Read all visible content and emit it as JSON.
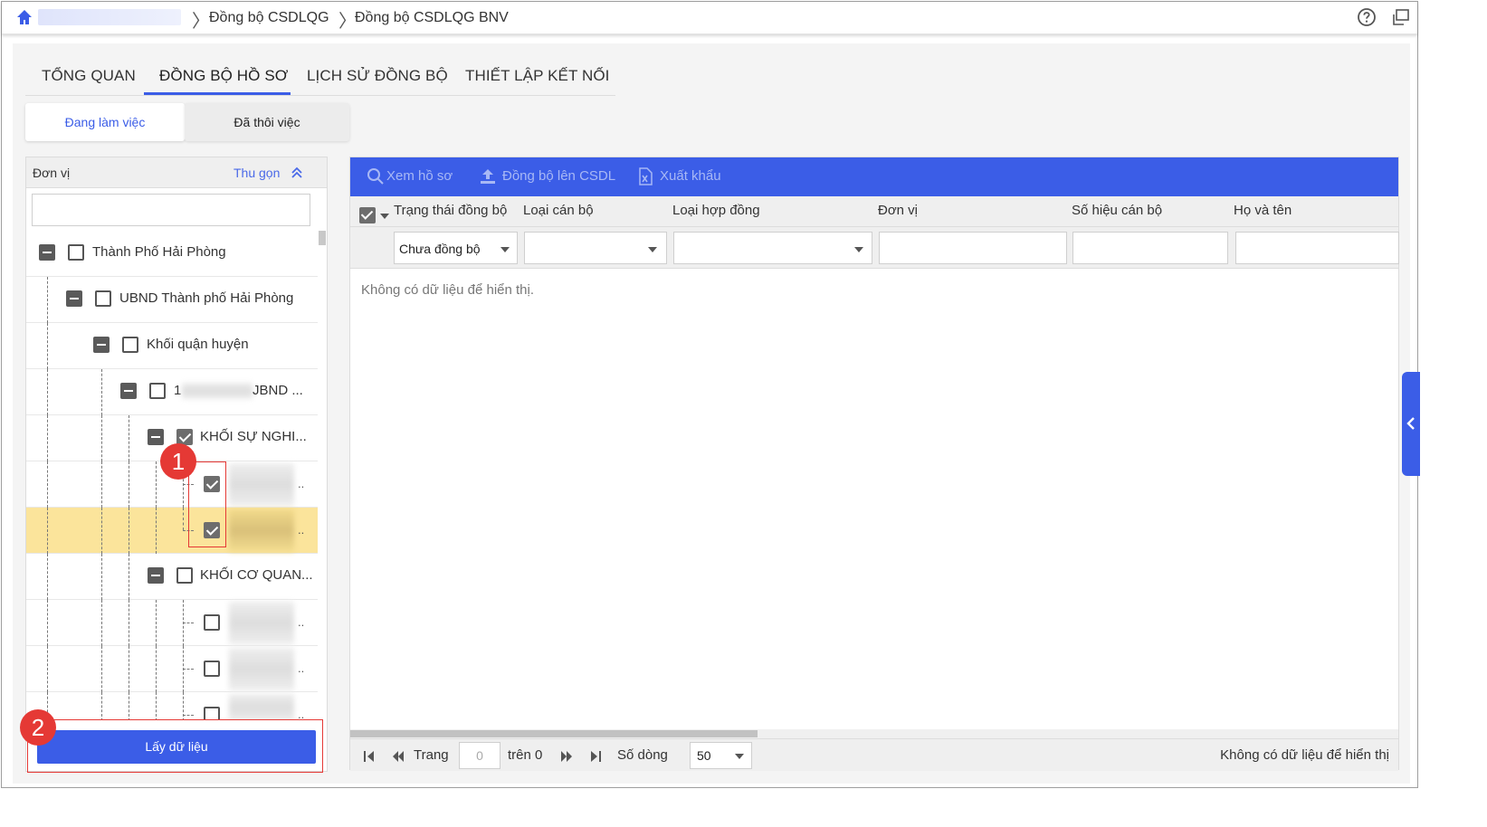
{
  "breadcrumb": {
    "items": [
      "Đồng bộ CSDLQG",
      "Đồng bộ CSDLQG BNV"
    ]
  },
  "tabs": [
    "TỔNG QUAN",
    "ĐỒNG BỘ HỒ SƠ",
    "LỊCH SỬ ĐỒNG BỘ",
    "THIẾT LẬP KẾT NỐI"
  ],
  "subtabs": [
    "Đang làm việc",
    "Đã thôi việc"
  ],
  "left_panel": {
    "title": "Đơn vị",
    "collapse_label": "Thu gọn",
    "tree": [
      {
        "label": "Thành Phố Hải Phòng",
        "checked": false
      },
      {
        "label": "UBND Thành phố Hải Phòng",
        "checked": false
      },
      {
        "label": "Khối quận huyện",
        "checked": false
      },
      {
        "label_prefix": "1",
        "label_suffix": "JBND ...",
        "checked": false
      },
      {
        "label": "KHỐI SỰ NGHI...",
        "checked": true
      },
      {
        "ellipsis": "..",
        "checked": true
      },
      {
        "ellipsis": "..",
        "checked": true
      },
      {
        "label": "KHỐI CƠ QUAN...",
        "checked": false
      },
      {
        "ellipsis": "..",
        "checked": false
      },
      {
        "ellipsis": "..",
        "checked": false
      },
      {
        "ellipsis": "..",
        "checked": false
      }
    ],
    "get_data_button": "Lấy dữ liệu"
  },
  "markers": [
    "1",
    "2"
  ],
  "toolbar": {
    "view": "Xem hồ sơ",
    "sync": "Đồng bộ lên CSDL",
    "export": "Xuất khẩu"
  },
  "table": {
    "columns": [
      "Trạng thái đồng bộ",
      "Loại cán bộ",
      "Loại hợp đồng",
      "Đơn vị",
      "Số hiệu cán bộ",
      "Họ và tên"
    ],
    "status_filter": "Chưa đồng bộ",
    "empty_message": "Không có dữ liệu để hiển thị."
  },
  "pager": {
    "page_label": "Trang",
    "page_value": "0",
    "of_label": "trên 0",
    "rows_label": "Số dòng",
    "rows_value": "50",
    "status": "Không có dữ liệu để hiển thị"
  },
  "colors": {
    "accent": "#3b5de7",
    "highlight_row": "#fbe49b",
    "marker": "#e53935"
  }
}
